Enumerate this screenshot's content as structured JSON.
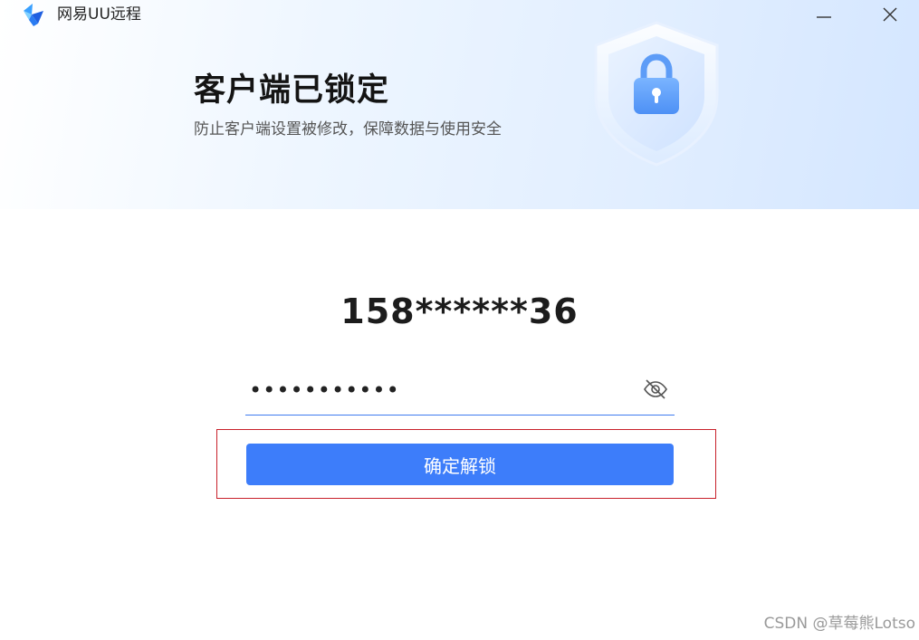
{
  "window": {
    "title": "网易UU远程",
    "icons": [
      "app-logo-icon",
      "minimize-icon",
      "close-icon"
    ]
  },
  "header": {
    "title": "客户端已锁定",
    "subtitle": "防止客户端设置被修改，保障数据与使用安全",
    "illustration": "shield-lock-icon"
  },
  "account": {
    "masked_phone": "158******36"
  },
  "password": {
    "value": "•••••••••••",
    "toggle_icon": "eye-off-icon"
  },
  "actions": {
    "unlock_label": "确定解锁"
  },
  "watermark": {
    "text": "CSDN @草莓熊Lotso"
  },
  "colors": {
    "primary": "#3d7dfa",
    "highlight_box": "#c8202a",
    "header_bg": "#e1eeff"
  }
}
